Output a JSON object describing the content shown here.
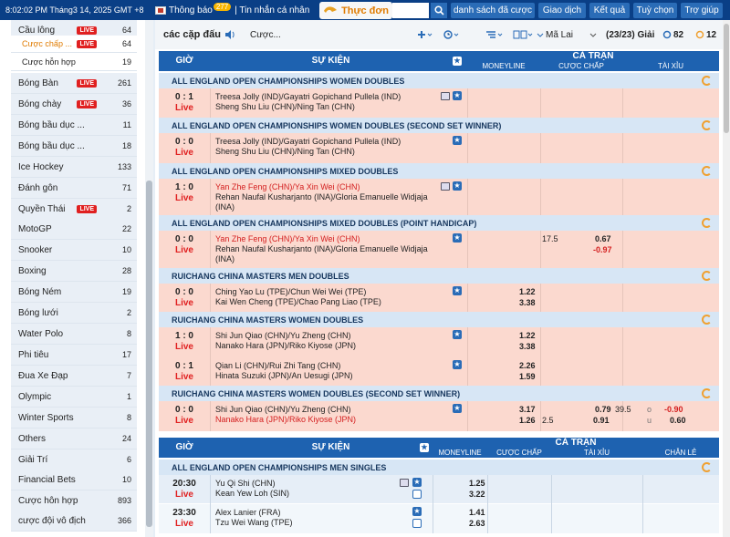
{
  "topbar": {
    "clock": "8:02:02 PM Tháng3 14, 2025 GMT +8",
    "notify_label": "Thông báo",
    "notify_count": "277",
    "inbox": "| Tin nhắn cá nhân",
    "menu_label": "Thực đơn",
    "nav": [
      "danh sách đã cược",
      "Giao dịch",
      "Kết quả",
      "Tuỳ chọn",
      "Trợ giúp"
    ]
  },
  "sidebar": {
    "items": [
      {
        "name": "Cầu lông",
        "live": true,
        "count": "64"
      },
      {
        "name": "Cược chấp ...",
        "live": true,
        "count": "64",
        "sub": true,
        "orange": true
      },
      {
        "name": "Cược hỗn hợp",
        "live": false,
        "count": "19",
        "sub": true
      },
      {
        "name": "Bóng Bàn",
        "live": true,
        "count": "261"
      },
      {
        "name": "Bóng chày",
        "live": true,
        "count": "36"
      },
      {
        "name": "Bóng bầu dục ...",
        "live": false,
        "count": "11"
      },
      {
        "name": "Bóng bầu dục ...",
        "live": false,
        "count": "18"
      },
      {
        "name": "Ice Hockey",
        "live": false,
        "count": "133"
      },
      {
        "name": "Đánh gôn",
        "live": false,
        "count": "71"
      },
      {
        "name": "Quyền Thái",
        "live": true,
        "count": "2"
      },
      {
        "name": "MotoGP",
        "live": false,
        "count": "22"
      },
      {
        "name": "Snooker",
        "live": false,
        "count": "10"
      },
      {
        "name": "Boxing",
        "live": false,
        "count": "28"
      },
      {
        "name": "Bóng Ném",
        "live": false,
        "count": "19"
      },
      {
        "name": "Bóng lưới",
        "live": false,
        "count": "2"
      },
      {
        "name": "Water Polo",
        "live": false,
        "count": "8"
      },
      {
        "name": "Phi tiêu",
        "live": false,
        "count": "17"
      },
      {
        "name": "Đua Xe Đạp",
        "live": false,
        "count": "7"
      },
      {
        "name": "Olympic",
        "live": false,
        "count": "1"
      },
      {
        "name": "Winter Sports",
        "live": false,
        "count": "8"
      },
      {
        "name": "Others",
        "live": false,
        "count": "24"
      },
      {
        "name": "Giải Trí",
        "live": false,
        "count": "6"
      },
      {
        "name": "Financial Bets",
        "live": false,
        "count": "10"
      },
      {
        "name": "Cược hỗn hợp",
        "live": false,
        "count": "893"
      },
      {
        "name": "cược đội vô địch",
        "live": false,
        "count": "366"
      }
    ],
    "live_label": "LIVE"
  },
  "toolbar": {
    "title": "các cặp đấu",
    "filter": "Cược...",
    "odds_type": "Mã Lai",
    "count": "(23/23) Giải",
    "refresh_a": "82",
    "refresh_b": "12"
  },
  "table1": {
    "header": {
      "time": "GIỜ",
      "event": "SỰ KIỆN",
      "group": "CẢ TRẬN",
      "moneyline": "MONEYLINE",
      "handicap": "CƯỢC CHẤP",
      "overunder": "TÀI XỈU"
    },
    "rows": [
      {
        "type": "league",
        "name": "ALL ENGLAND OPEN CHAMPIONSHIPS WOMEN DOUBLES"
      },
      {
        "type": "match",
        "score": "0 : 1",
        "status": "Live",
        "home": "Treesa Jolly (IND)/Gayatri Gopichand Pullela (IND)",
        "away": "Sheng Shu Liu (CHN)/Ning Tan (CHN)"
      },
      {
        "type": "league",
        "name": "ALL ENGLAND OPEN CHAMPIONSHIPS WOMEN DOUBLES (SECOND SET WINNER)"
      },
      {
        "type": "match",
        "score": "0 : 0",
        "status": "Live",
        "home": "Treesa Jolly (IND)/Gayatri Gopichand Pullela (IND)",
        "away": "Sheng Shu Liu (CHN)/Ning Tan (CHN)"
      },
      {
        "type": "league",
        "name": "ALL ENGLAND OPEN CHAMPIONSHIPS MIXED DOUBLES"
      },
      {
        "type": "match",
        "score": "1 : 0",
        "status": "Live",
        "home": "Yan Zhe Feng (CHN)/Ya Xin Wei (CHN)",
        "away": "Rehan Naufal Kusharjanto (INA)/Gloria Emanuelle Widjaja (INA)"
      },
      {
        "type": "league",
        "name": "ALL ENGLAND OPEN CHAMPIONSHIPS MIXED DOUBLES (POINT HANDICAP)"
      },
      {
        "type": "match",
        "score": "0 : 0",
        "status": "Live",
        "home": "Yan Zhe Feng (CHN)/Ya Xin Wei (CHN)",
        "away": "Rehan Naufal Kusharjanto (INA)/Gloria Emanuelle Widjaja (INA)",
        "hcp_line": "17.5",
        "hcp_home": "0.67",
        "hcp_away": "-0.97"
      },
      {
        "type": "league",
        "name": "RUICHANG CHINA MASTERS MEN DOUBLES"
      },
      {
        "type": "match",
        "score": "0 : 0",
        "status": "Live",
        "home": "Ching Yao Lu (TPE)/Chun Wei Wei (TPE)",
        "away": "Kai Wen Cheng (TPE)/Chao Pang Liao (TPE)",
        "ml_home": "1.22",
        "ml_away": "3.38"
      },
      {
        "type": "league",
        "name": "RUICHANG CHINA MASTERS WOMEN DOUBLES"
      },
      {
        "type": "match",
        "score": "1 : 0",
        "status": "Live",
        "home": "Shi Jun Qiao (CHN)/Yu Zheng (CHN)",
        "away": "Nanako Hara (JPN)/Riko Kiyose (JPN)",
        "ml_home": "1.22",
        "ml_away": "3.38"
      },
      {
        "type": "match",
        "score": "0 : 1",
        "status": "Live",
        "home": "Qian Li (CHN)/Rui Zhi Tang (CHN)",
        "away": "Hinata Suzuki (JPN)/An Uesugi (JPN)",
        "ml_home": "2.26",
        "ml_away": "1.59"
      },
      {
        "type": "league",
        "name": "RUICHANG CHINA MASTERS WOMEN DOUBLES (SECOND SET WINNER)"
      },
      {
        "type": "match",
        "score": "0 : 0",
        "status": "Live",
        "home": "Shi Jun Qiao (CHN)/Yu Zheng (CHN)",
        "away": "Nanako Hara (JPN)/Riko Kiyose (JPN)",
        "ml_home": "3.17",
        "ml_away": "1.26",
        "hcp_line2": "2.5",
        "hcp_home": "0.79",
        "hcp_away": "0.91",
        "ou_line": "39.5",
        "ou_o": "o",
        "ou_u": "u",
        "ou_home": "-0.90",
        "ou_away": "0.60"
      }
    ]
  },
  "table2": {
    "header": {
      "time": "GIỜ",
      "event": "SỰ KIỆN",
      "group": "CẢ TRẬN",
      "moneyline": "MONEYLINE",
      "handicap": "CƯỢC CHẤP",
      "overunder": "TÀI XỈU",
      "oddeven": "CHẴN LẺ"
    },
    "league": "ALL ENGLAND OPEN CHAMPIONSHIPS MEN SINGLES",
    "matches": [
      {
        "time": "20:30",
        "status": "Live",
        "home": "Yu Qi Shi (CHN)",
        "away": "Kean Yew Loh (SIN)",
        "ml_home": "1.25",
        "ml_away": "3.22"
      },
      {
        "time": "23:30",
        "status": "Live",
        "home": "Alex Lanier (FRA)",
        "away": "Tzu Wei Wang (TPE)",
        "ml_home": "1.41",
        "ml_away": "2.63"
      }
    ]
  },
  "colors": {
    "nav": "#0a3f86",
    "header": "#1e62b0",
    "league": "#d7e6f5",
    "match": "#fbd9cf",
    "live": "#e02020",
    "accent": "#e07b00"
  }
}
